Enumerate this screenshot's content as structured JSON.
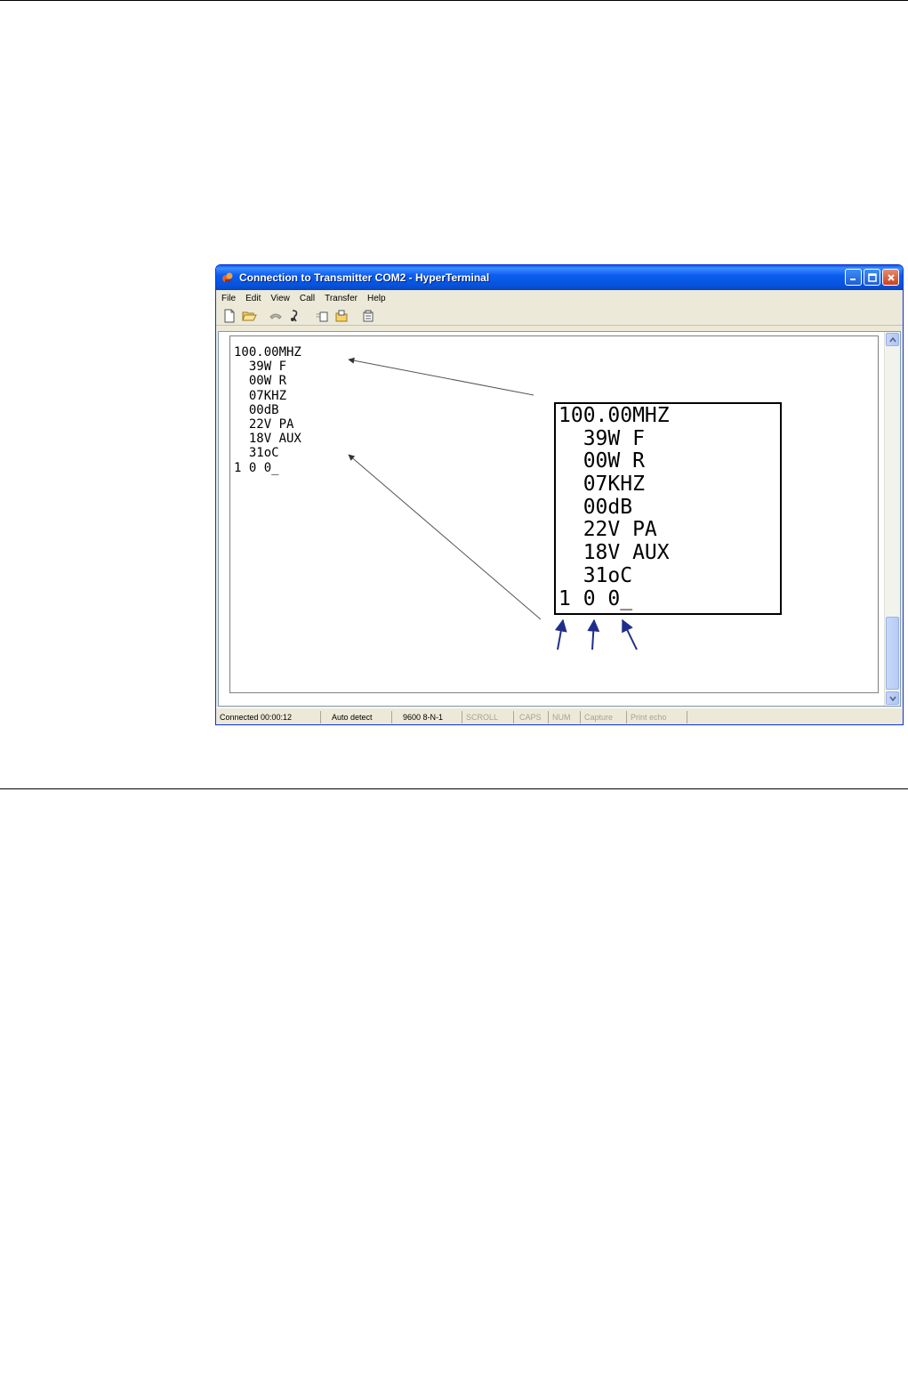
{
  "window": {
    "title": "Connection to Transmitter COM2 - HyperTerminal"
  },
  "menu": [
    "File",
    "Edit",
    "View",
    "Call",
    "Transfer",
    "Help"
  ],
  "toolbar": {
    "icons": [
      "new-document-icon",
      "open-folder-icon",
      "dial-phone-icon",
      "hang-up-icon",
      "send-file-icon",
      "receive-file-icon",
      "properties-icon"
    ]
  },
  "terminal": {
    "lines": [
      "100.00MHZ",
      "  39W F",
      "  00W R",
      "  07KHZ",
      "  00dB",
      "  22V PA",
      "  18V AUX",
      "  31oC",
      "1 0 0_"
    ]
  },
  "zoom": {
    "lines": [
      "100.00MHZ",
      "  39W F",
      "  00W R",
      "  07KHZ",
      "  00dB",
      "  22V PA",
      "  18V AUX",
      "  31oC",
      "1 0 0_"
    ]
  },
  "statusbar": {
    "connected": "Connected 00:00:12",
    "detect": "Auto detect",
    "settings": "9600 8-N-1",
    "scroll": "SCROLL",
    "caps": "CAPS",
    "num": "NUM",
    "capture": "Capture",
    "print_echo": "Print echo"
  },
  "colors": {
    "titlebar": "#0c5df0",
    "window_face": "#ece9d8",
    "annotation_arrow": "#1f2e8c",
    "pointer_arrow": "#555555"
  }
}
